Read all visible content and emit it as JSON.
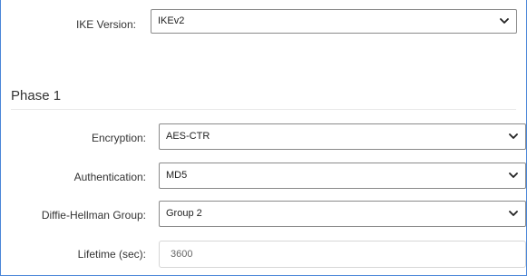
{
  "ike": {
    "label": "IKE Version:",
    "value": "IKEv2"
  },
  "phase1": {
    "title": "Phase 1",
    "encryption": {
      "label": "Encryption:",
      "value": "AES-CTR"
    },
    "authentication": {
      "label": "Authentication:",
      "value": "MD5"
    },
    "dh_group": {
      "label": "Diffie-Hellman Group:",
      "value": "Group 2"
    },
    "lifetime": {
      "label": "Lifetime (sec):",
      "value": "3600"
    }
  },
  "icons": {
    "dropdown": "chevron-down-icon"
  },
  "colors": {
    "frame_border": "#4a86d8",
    "select_border": "#8a8a8a"
  }
}
